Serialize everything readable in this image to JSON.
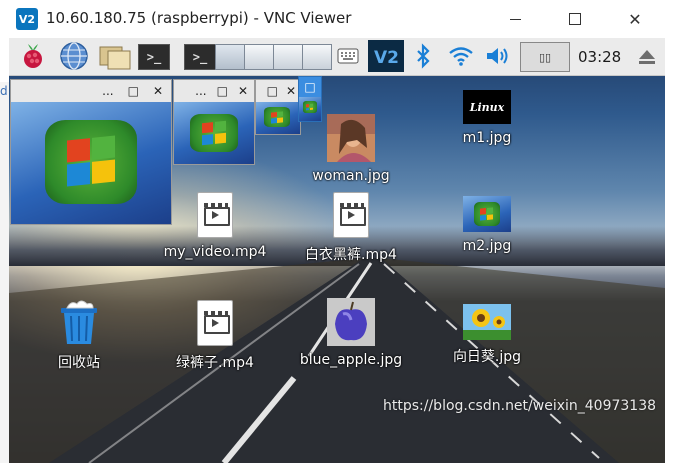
{
  "window": {
    "title": "10.60.180.75 (raspberrypi) - VNC Viewer",
    "logo_text": "V2",
    "minimize_label": "",
    "maximize_label": "",
    "close_label": "✕"
  },
  "taskbar": {
    "clock": "03:28",
    "terminal_label": ">_",
    "tray_box_label": "▯▯",
    "apps": [
      "",
      "",
      "",
      "",
      ""
    ]
  },
  "left_edge_text": "d",
  "thumb_windows": [
    {
      "controls": [
        "...",
        "□",
        "✕"
      ]
    },
    {
      "controls": [
        "...",
        "□",
        "✕"
      ]
    },
    {
      "controls": [
        "□",
        "✕"
      ]
    },
    {
      "controls": [
        "□"
      ]
    }
  ],
  "desktop": {
    "icons": [
      {
        "label": "woman.jpg"
      },
      {
        "label": "m1.jpg",
        "thumb_text": "Linux"
      },
      {
        "label": "my_video.mp4"
      },
      {
        "label": "白衣黑裤.mp4"
      },
      {
        "label": "m2.jpg"
      },
      {
        "label": "回收站"
      },
      {
        "label": "绿裤子.mp4"
      },
      {
        "label": "blue_apple.jpg"
      },
      {
        "label": "向日葵.jpg"
      }
    ]
  },
  "watermark": "https://blog.csdn.net/weixin_40973138",
  "colors": {
    "taskbar_bg": "#ebebeb",
    "vnc_blue": "#0b75bd",
    "bluetooth": "#1a7fd6",
    "network": "#1a7fd6"
  }
}
